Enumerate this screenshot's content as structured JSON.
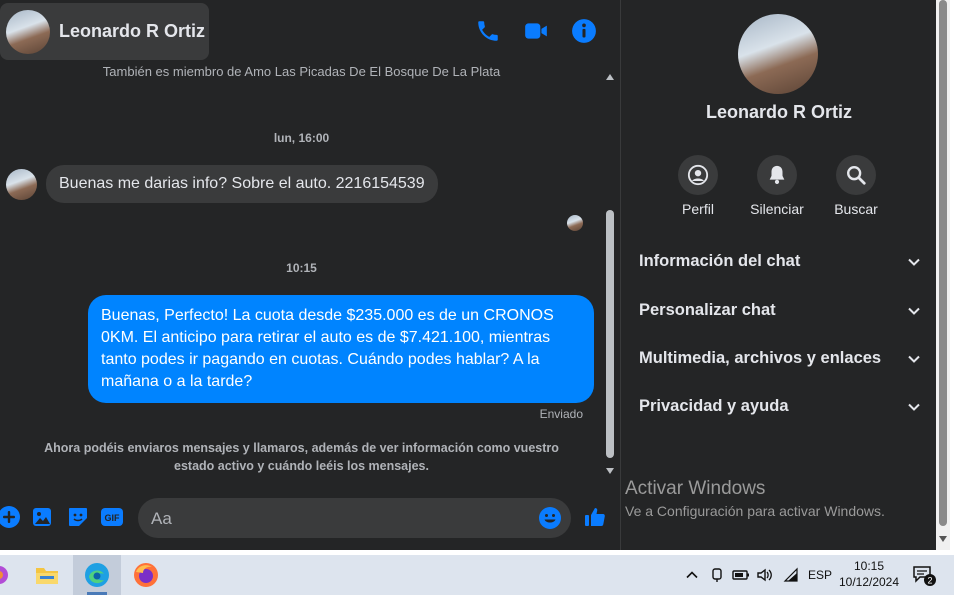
{
  "header": {
    "contact_name": "Leonardo R Ortiz",
    "icons": [
      "phone-icon",
      "video-icon",
      "info-icon"
    ]
  },
  "messages": {
    "system_top": "También es miembro de Amo Las Picadas De El Bosque De La Plata",
    "timestamp_1": "lun, 16:00",
    "incoming_text": "Buenas me darias info? Sobre el auto. 2216154539",
    "timestamp_2": "10:15",
    "outgoing_text": "Buenas, Perfecto! La cuota desde $235.000 es de un CRONOS 0KM. El anticipo para retirar el auto es de $7.421.100, mientras tanto podes ir pagando en cuotas. Cuándo podes hablar? A la mañana o a la tarde?",
    "status": "Enviado",
    "system_bottom": "Ahora podéis enviaros mensajes y llamaros, además de ver información como vuestro estado activo y cuándo leéis los mensajes."
  },
  "composer": {
    "placeholder": "Aa",
    "icons": [
      "plus-icon",
      "image-icon",
      "sticker-icon",
      "gif-icon",
      "emoji-icon",
      "like-icon"
    ]
  },
  "panel": {
    "contact_name": "Leonardo R Ortiz",
    "actions": [
      {
        "label": "Perfil",
        "icon": "profile-icon"
      },
      {
        "label": "Silenciar",
        "icon": "bell-icon"
      },
      {
        "label": "Buscar",
        "icon": "search-icon"
      }
    ],
    "sections": [
      {
        "label": "Información del chat"
      },
      {
        "label": "Personalizar chat"
      },
      {
        "label": "Multimedia, archivos y enlaces"
      },
      {
        "label": "Privacidad y ayuda"
      }
    ]
  },
  "watermark": {
    "title": "Activar Windows",
    "subtitle": "Ve a Configuración para activar Windows."
  },
  "taskbar": {
    "language": "ESP",
    "time": "10:15",
    "date": "10/12/2024",
    "notification_count": "2"
  },
  "colors": {
    "accent": "#0a7cff",
    "outgoing_bubble": "#0084ff",
    "background": "#242526",
    "incoming_bubble": "#3a3b3c"
  }
}
